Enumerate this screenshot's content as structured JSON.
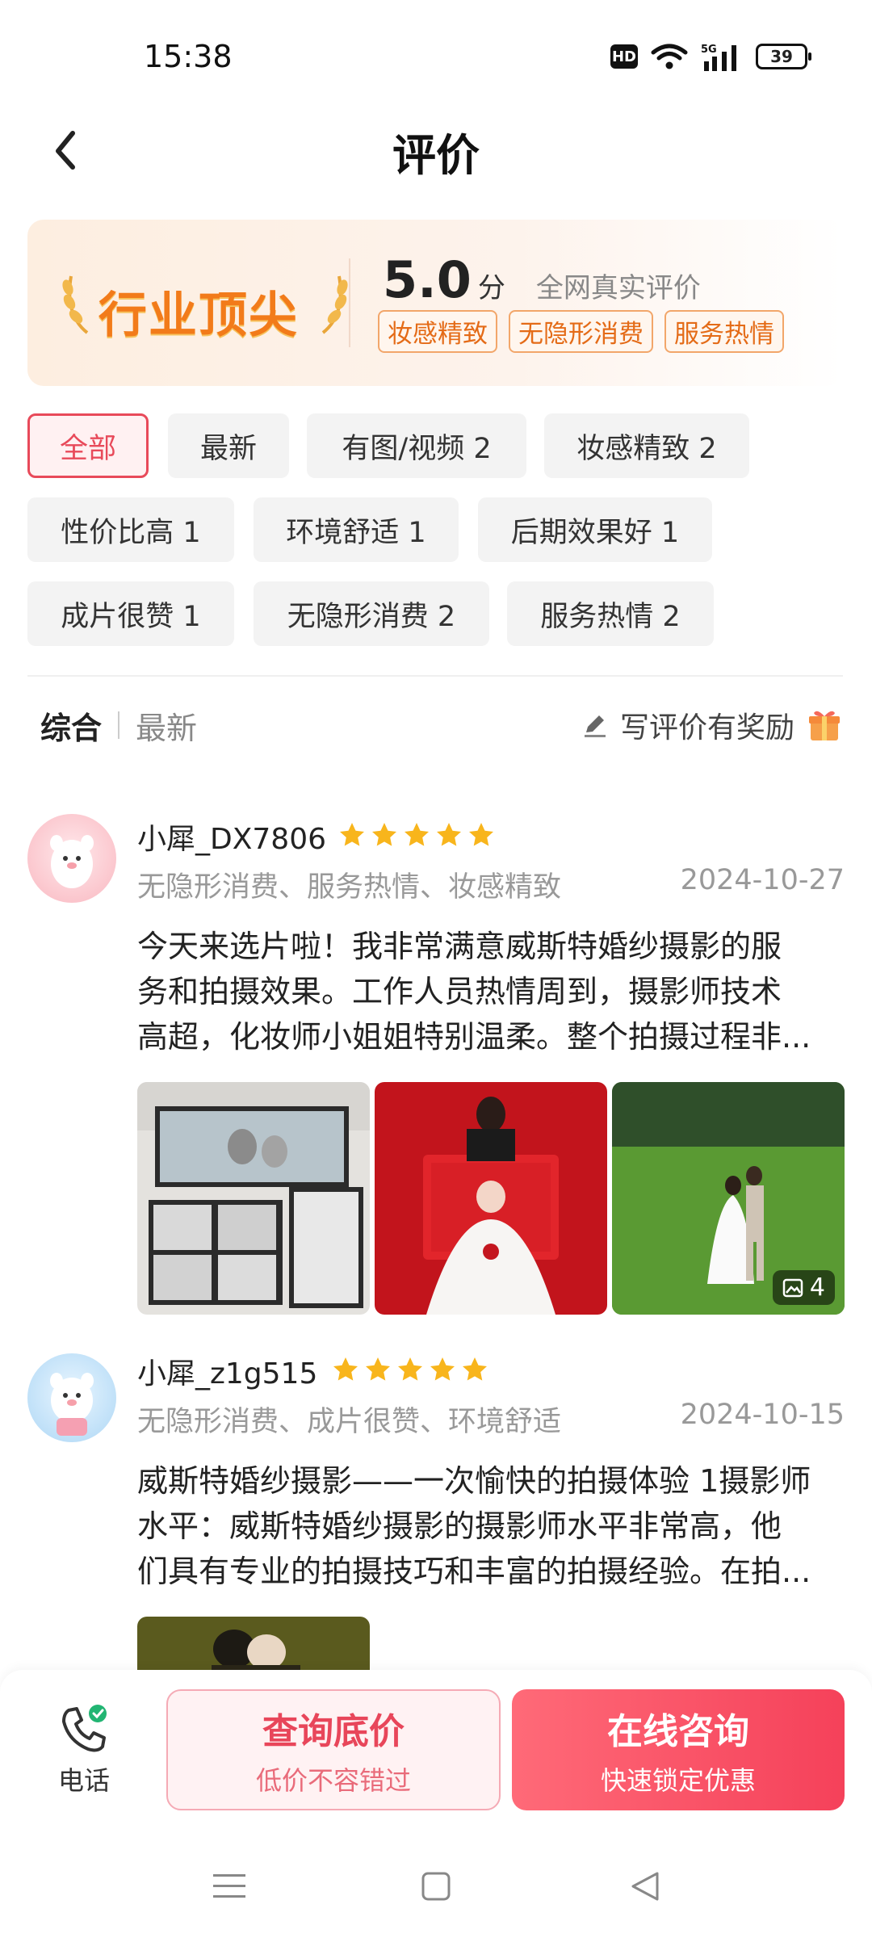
{
  "status_bar": {
    "time": "15:38",
    "hd_label": "HD",
    "network_label": "5G",
    "battery": "39"
  },
  "header": {
    "title": "评价"
  },
  "banner": {
    "badge": "行业顶尖",
    "score": "5.0",
    "score_unit": "分",
    "score_desc": "全网真实评价",
    "tags": [
      "妆感精致",
      "无隐形消费",
      "服务热情"
    ]
  },
  "filters": [
    "全部",
    "最新",
    "有图/视频 2",
    "妆感精致 2",
    "性价比高 1",
    "环境舒适 1",
    "后期效果好 1",
    "成片很赞 1",
    "无隐形消费 2",
    "服务热情 2"
  ],
  "sort": {
    "active": "综合",
    "inactive": "最新",
    "write_review": "写评价有奖励"
  },
  "reviews": [
    {
      "user": "小犀_DX7806",
      "rating": 5,
      "tags": "无隐形消费、服务热情、妆感精致",
      "date": "2024-10-27",
      "text_lines": [
        "今天来选片啦！我非常满意威斯特婚纱摄影的服",
        "务和拍摄效果。工作人员热情周到，摄影师技术",
        "高超，化妆师小姐姐特别温柔。整个拍摄过程非..."
      ],
      "photo_count": "4"
    },
    {
      "user": "小犀_z1g515",
      "rating": 5,
      "tags": "无隐形消费、成片很赞、环境舒适",
      "date": "2024-10-15",
      "text_lines": [
        "威斯特婚纱摄影——一次愉快的拍摄体验 1摄影师",
        "水平：威斯特婚纱摄影的摄影师水平非常高，他",
        "们具有专业的拍摄技巧和丰富的拍摄经验。在拍..."
      ]
    }
  ],
  "actions": {
    "phone": "电话",
    "price_main": "查询底价",
    "price_sub": "低价不容错过",
    "consult_main": "在线咨询",
    "consult_sub": "快速锁定优惠"
  },
  "colors": {
    "accent": "#e84a5a",
    "banner_orange": "#f27b1a",
    "star": "#f8b51c"
  }
}
